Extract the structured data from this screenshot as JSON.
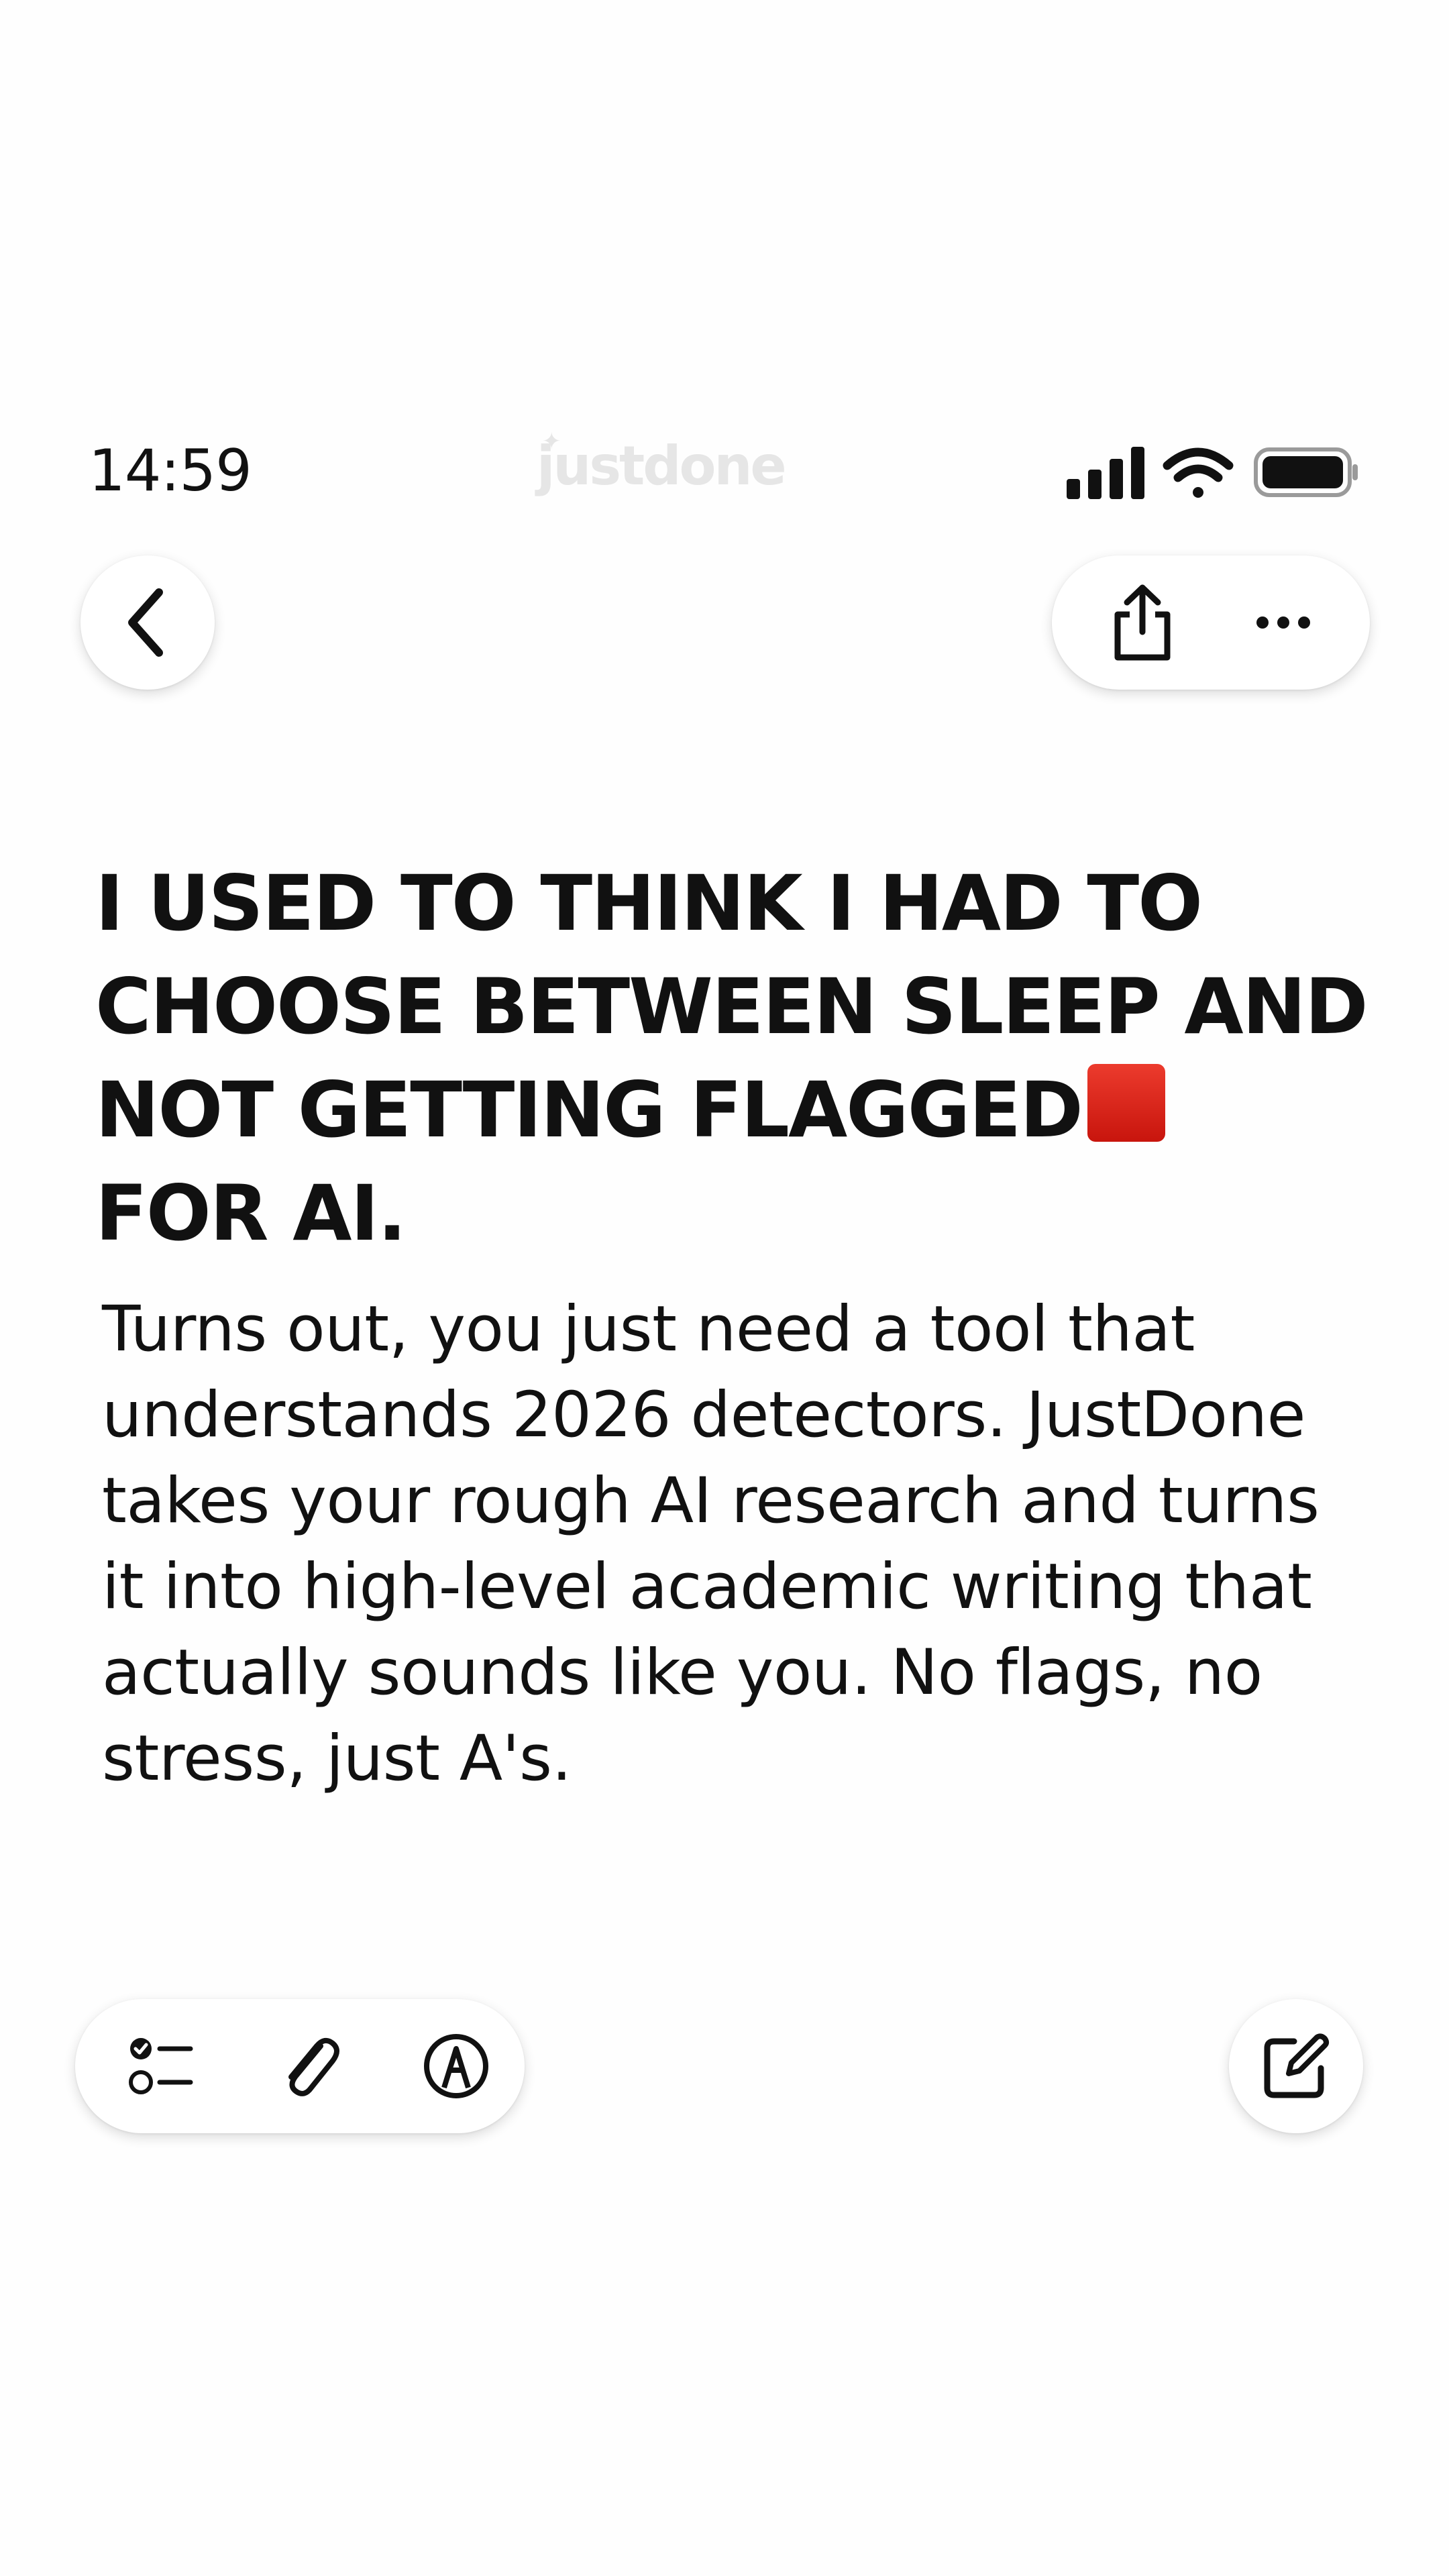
{
  "status_bar": {
    "time": "14:59",
    "brand": "justdone",
    "icons": [
      "cellular-signal-icon",
      "wifi-icon",
      "battery-icon"
    ]
  },
  "toolbar_top": {
    "back_icon": "chevron-left-icon",
    "share_icon": "share-icon",
    "more_icon": "more-icon"
  },
  "note": {
    "headline_text": "I USED TO THINK I HAD TO CHOOSE BETWEEN SLEEP AND NOT GETTING FLAGGED",
    "headline_emoji": "red-square",
    "headline_tail": "FOR AI.",
    "body": "Turns out, you just need a tool that understands 2026 detectors. JustDone takes your rough AI research and turns it into high-level academic writing that actually sounds like you. No flags, no stress, just A's."
  },
  "toolbar_bottom": {
    "icons": [
      "checklist-icon",
      "paperclip-icon",
      "markup-icon",
      "compose-icon"
    ]
  },
  "colors": {
    "background": "#fefefe",
    "text": "#111111",
    "brand_watermark": "#e6e6e6",
    "flag_red": "#e02a1f"
  }
}
